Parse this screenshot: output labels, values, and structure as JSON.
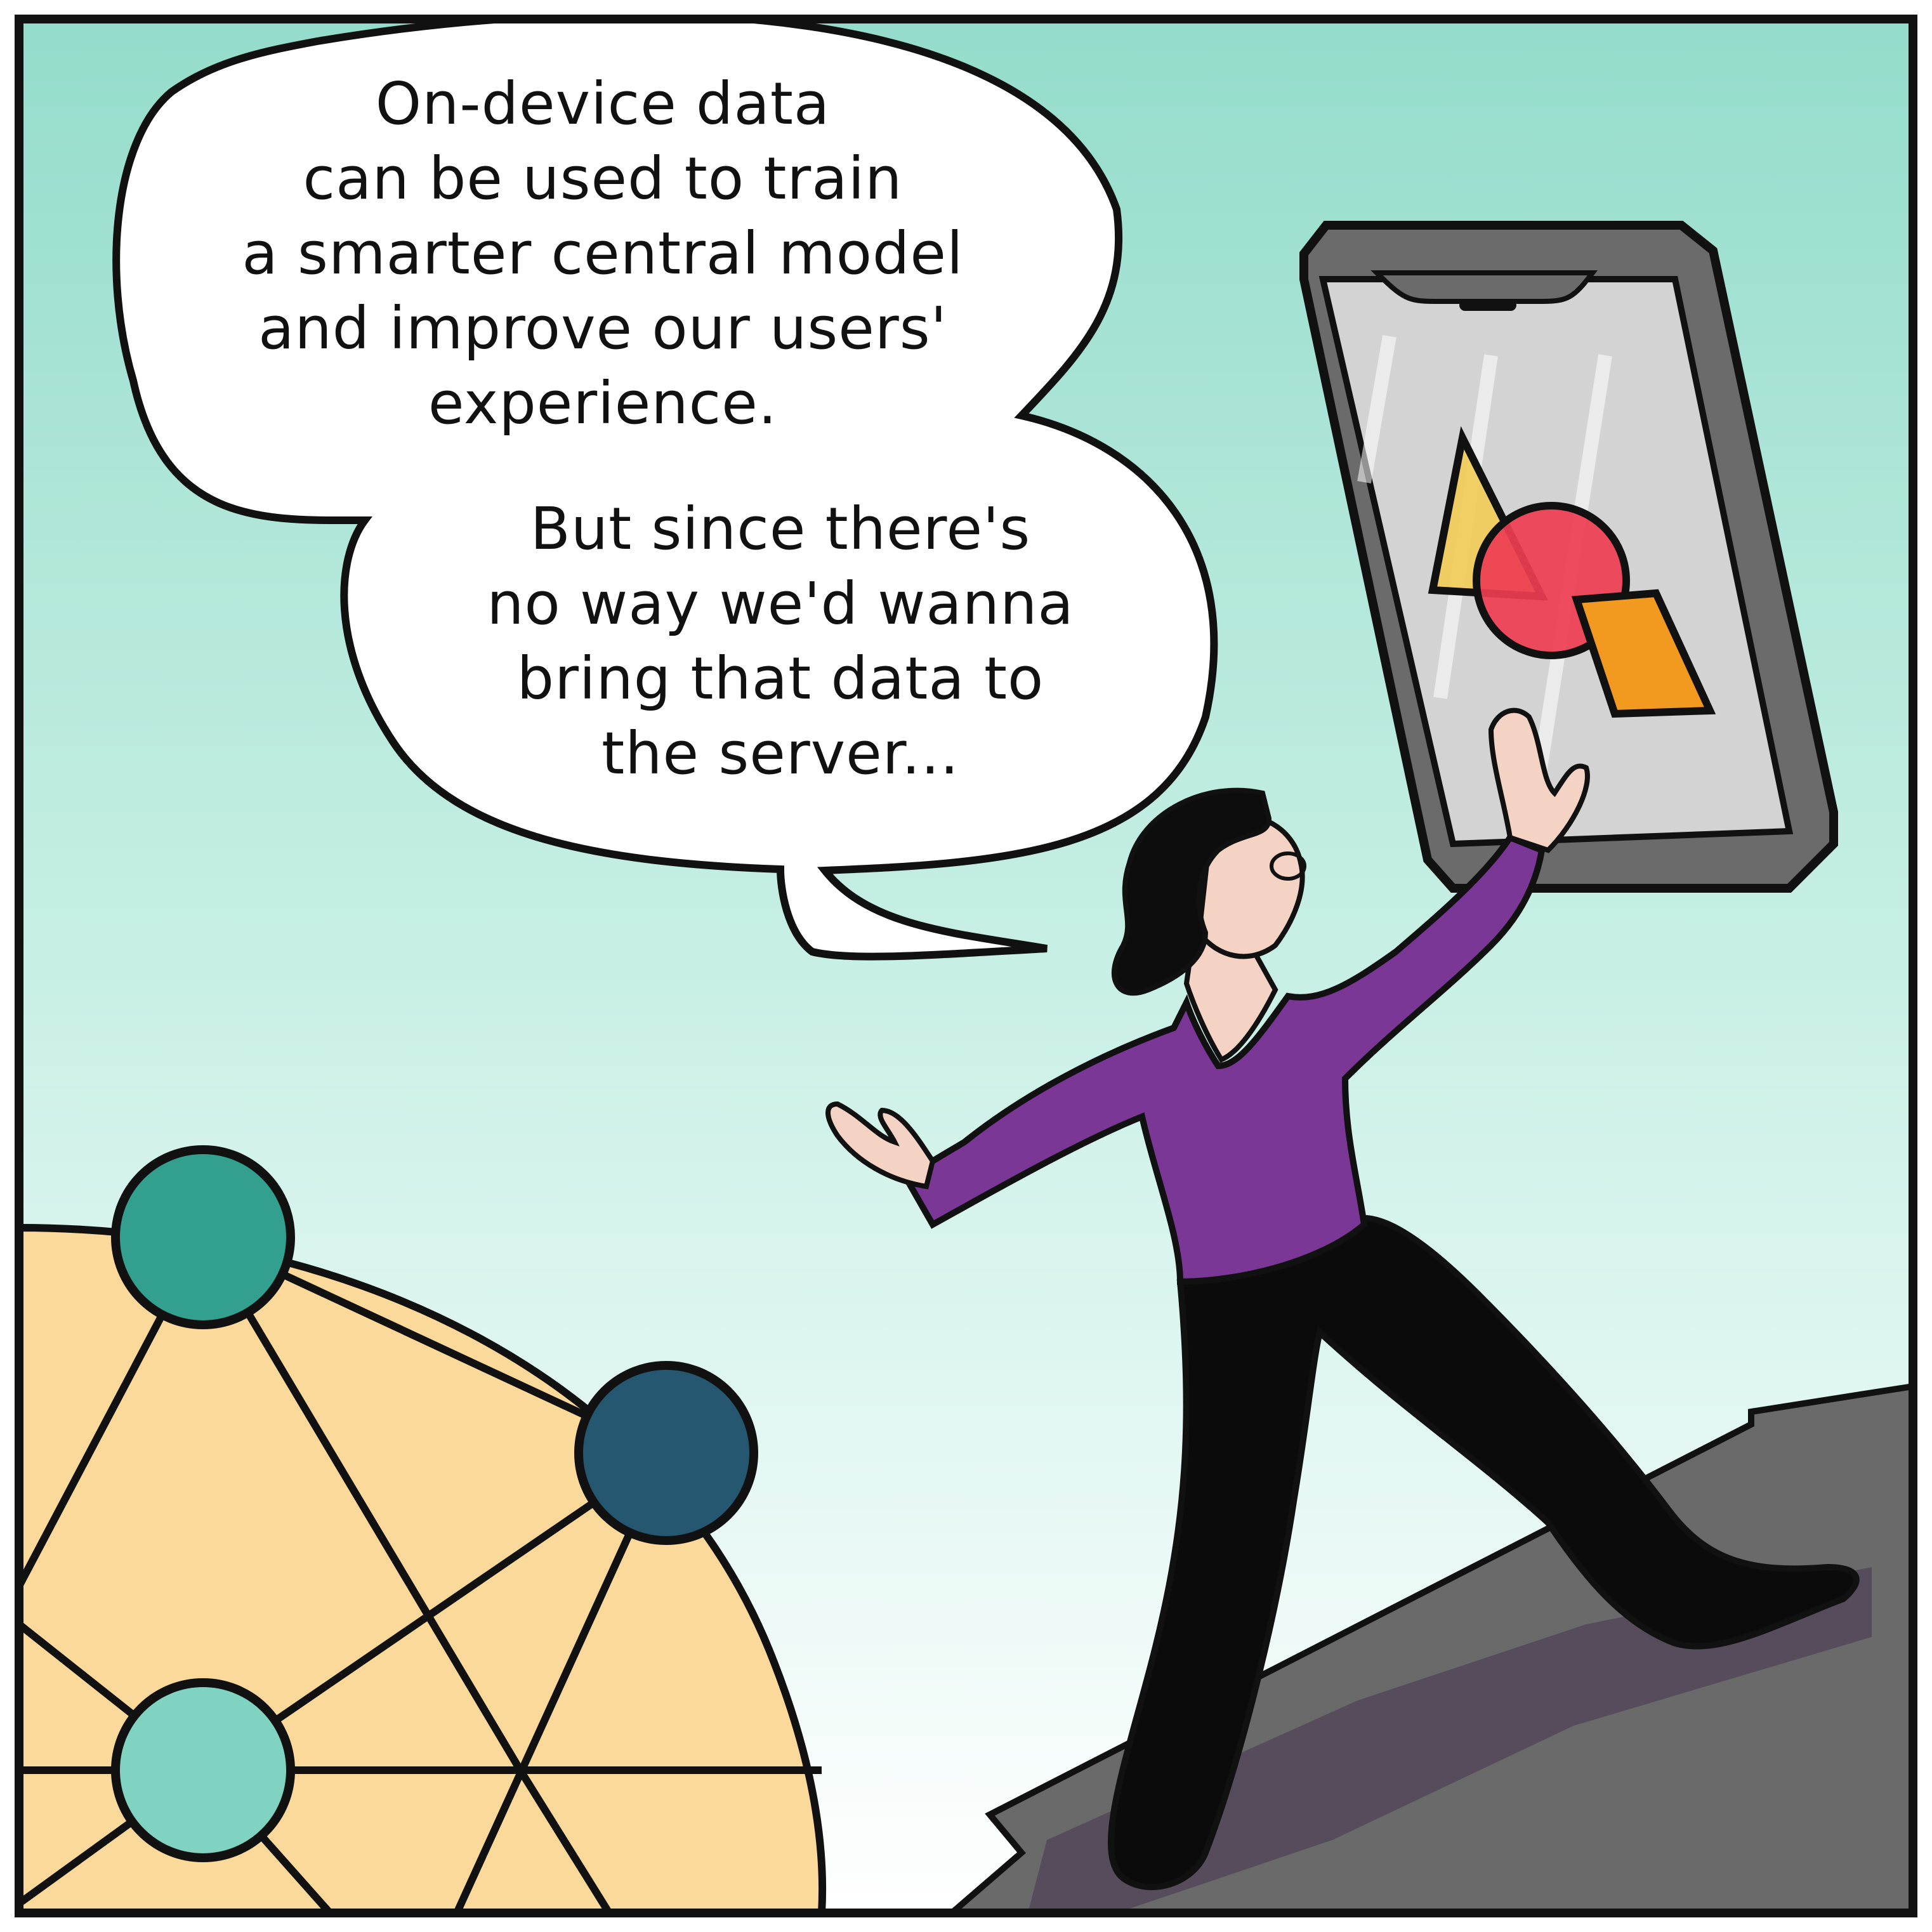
{
  "speech_balloon": {
    "lines_top": [
      "On-device data",
      "can be used to train",
      "a smarter central model",
      "and improve our users'",
      "experience."
    ],
    "lines_bottom": [
      "But since there's",
      "no way we'd wanna",
      "bring that data to",
      "the server..."
    ]
  },
  "colors": {
    "sky_top": "#94dccb",
    "sky_bottom": "#ffffff",
    "ink": "#111111",
    "shirt": "#7b3796",
    "pants": "#0b0b0b",
    "skin": "#f5d3c4",
    "hair": "#0d0d0d",
    "ground": "#6a6a6a",
    "shadow": "#574c5b",
    "phone_body": "#6b6b6b",
    "phone_screen": "#d3d3d3",
    "triangle": "#f3cc55",
    "circle": "#ee3d52",
    "diamond": "#f29a1f",
    "dome": "#fbd99a",
    "node_dark": "#255870",
    "node_mid": "#33a08f",
    "node_light": "#7fd3c0"
  },
  "icons": [
    "phone-icon",
    "triangle-shape-icon",
    "circle-shape-icon",
    "diamond-shape-icon",
    "network-node-icon"
  ]
}
